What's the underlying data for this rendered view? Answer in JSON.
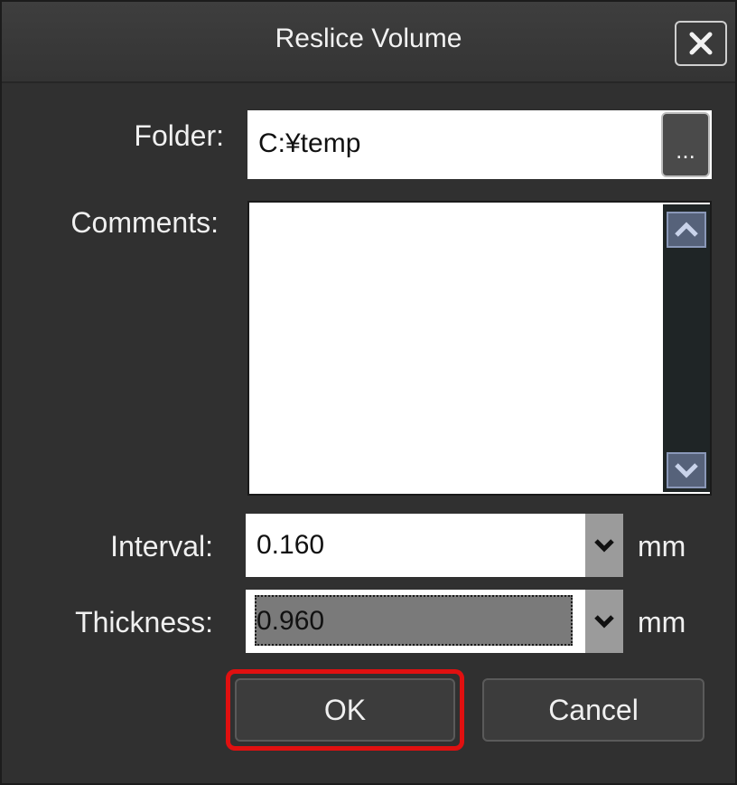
{
  "dialog": {
    "title": "Reslice Volume",
    "close_icon": "close-icon"
  },
  "folder": {
    "label": "Folder:",
    "value": "C:¥temp",
    "browse_label": "..."
  },
  "comments": {
    "label": "Comments:",
    "value": ""
  },
  "interval": {
    "label": "Interval:",
    "value": "0.160",
    "unit": "mm"
  },
  "thickness": {
    "label": "Thickness:",
    "value": "0.960",
    "unit": "mm"
  },
  "buttons": {
    "ok": "OK",
    "cancel": "Cancel"
  },
  "colors": {
    "background": "#303030",
    "highlight": "#e01010",
    "field": "#ffffff",
    "scroll_arrow": "#56627a"
  }
}
